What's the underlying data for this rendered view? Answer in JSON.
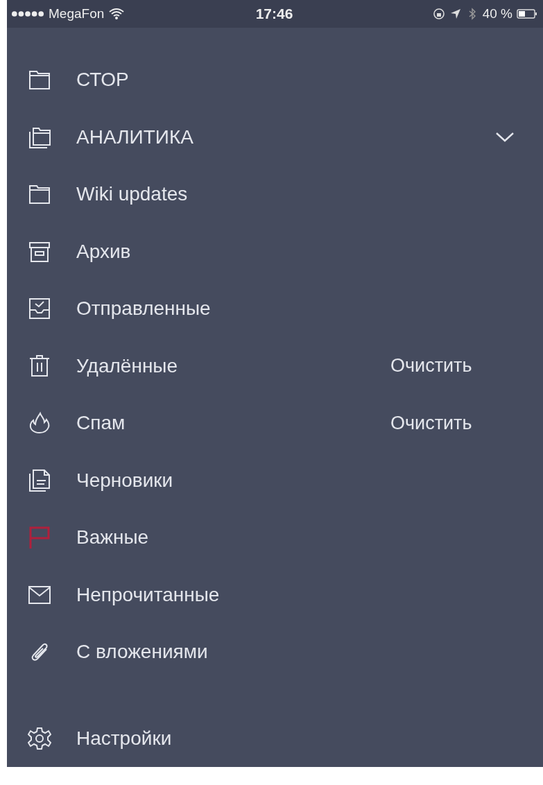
{
  "status_bar": {
    "carrier": "MegaFon",
    "time": "17:46",
    "battery": "40 %"
  },
  "folders": [
    {
      "kind": "folder",
      "label": "СТОР"
    },
    {
      "kind": "folder-group",
      "label": "АНАЛИТИКА",
      "expanded": false
    },
    {
      "kind": "folder",
      "label": "Wiki updates"
    },
    {
      "kind": "archive",
      "label": "Архив"
    },
    {
      "kind": "sent",
      "label": "Отправленные"
    },
    {
      "kind": "trash",
      "label": "Удалённые",
      "action": "Очистить"
    },
    {
      "kind": "spam",
      "label": "Спам",
      "action": "Очистить"
    },
    {
      "kind": "drafts",
      "label": "Черновики"
    },
    {
      "kind": "flagged",
      "label": "Важные"
    },
    {
      "kind": "unread",
      "label": "Непрочитанные"
    },
    {
      "kind": "attachments",
      "label": "С вложениями"
    }
  ],
  "settings": {
    "label": "Настройки"
  }
}
